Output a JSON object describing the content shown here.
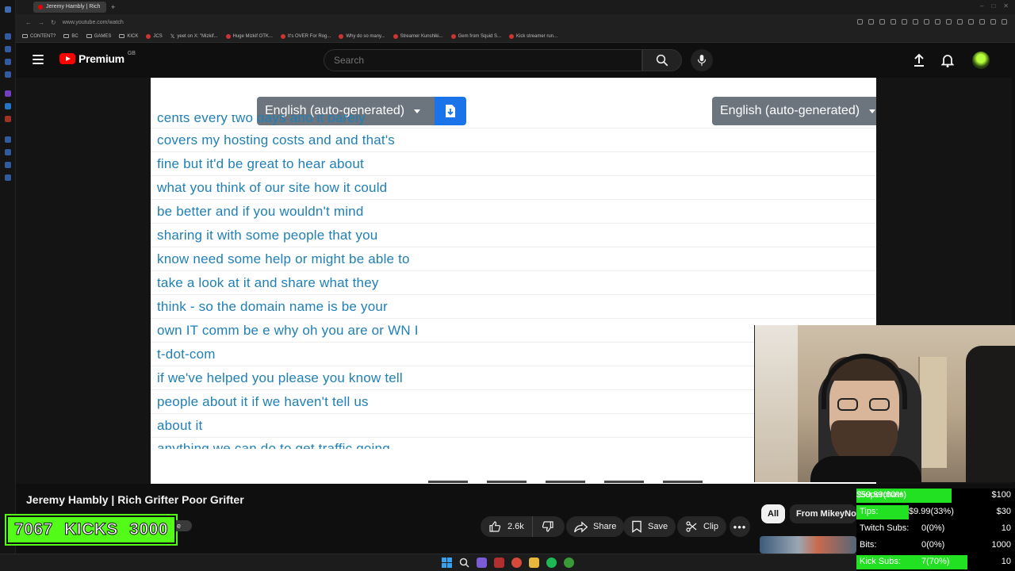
{
  "browser": {
    "tab_title": "Jeremy Hambly | Rich",
    "tab_add": "+",
    "url": "www.youtube.com/watch",
    "bookmarks": [
      {
        "label": "CONTENT?",
        "kind": "folder"
      },
      {
        "label": "BC",
        "kind": "folder"
      },
      {
        "label": "GAMES",
        "kind": "folder"
      },
      {
        "label": "KICK",
        "kind": "folder"
      },
      {
        "label": "JCS",
        "kind": "yt"
      },
      {
        "label": "yeet on X: \"Mizkif...",
        "kind": "x"
      },
      {
        "label": "Huge Mizkif OTK...",
        "kind": "yt"
      },
      {
        "label": "It's OVER For Rog...",
        "kind": "yt"
      },
      {
        "label": "Why do so many...",
        "kind": "yt"
      },
      {
        "label": "Streamer Kunshiki...",
        "kind": "yt"
      },
      {
        "label": "Gem from Squid S...",
        "kind": "yt"
      },
      {
        "label": "Kick streamer run...",
        "kind": "yt"
      }
    ]
  },
  "header": {
    "logo_text": "Premium",
    "logo_region": "GB",
    "search_placeholder": "Search"
  },
  "transcript": {
    "left_language": "English (auto-generated)",
    "right_language": "English (auto-generated)",
    "lines_top_cut": "cents every two days and it barely",
    "lines": [
      "covers my hosting costs and and that's",
      "fine but it'd be great to hear about",
      "what you think of our site how it could",
      "be better and if you wouldn't mind",
      "sharing it with some people that you",
      "know need some help or might be able to",
      "take a look at it and share what they",
      "think - so the domain name is be your",
      "own IT comm be e why oh you are or WN I",
      "t-dot-com",
      "if we've helped you please you know tell",
      "people about it if we haven't tell us",
      "about it"
    ],
    "lines_bottom_cut": "anything we can do to get traffic going"
  },
  "video": {
    "title": "Jeremy Hambly | Rich Grifter Poor Grifter",
    "likes": "2.6k",
    "share_label": "Share",
    "save_label": "Save",
    "clip_label": "Clip",
    "more_label": "•••"
  },
  "kicks_banner": {
    "current": "7067",
    "label": "KICKS",
    "goal": "3000",
    "peek_text": "e"
  },
  "chips": {
    "all": "All",
    "from": "From MikeyNoh"
  },
  "stats": {
    "fill_color": "#22e022",
    "rows": [
      {
        "label": "Superchats:",
        "value": "$59.89(60%)",
        "goal": "$100",
        "fill": 0.6
      },
      {
        "label": "Tips:",
        "value": "$9.99(33%)",
        "goal": "$30",
        "fill": 0.33
      },
      {
        "label": "Twitch Subs:",
        "value": "0(0%)",
        "goal": "10",
        "fill": 0
      },
      {
        "label": "Bits:",
        "value": "0(0%)",
        "goal": "1000",
        "fill": 0
      },
      {
        "label": "Kick Subs:",
        "value": "7(70%)",
        "goal": "10",
        "fill": 0.7
      }
    ]
  },
  "colors": {
    "youtube_red": "#ff0000",
    "transcript_text": "#1f7fb6",
    "download_blue": "#1a73e8",
    "language_gray": "#6c757d",
    "kick_green": "#53fc18"
  }
}
